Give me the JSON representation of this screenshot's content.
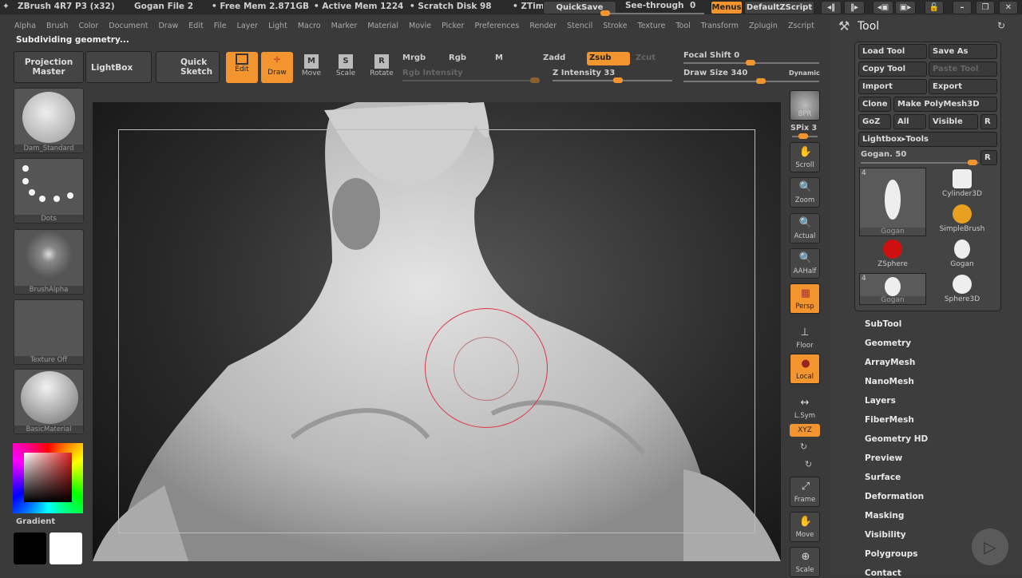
{
  "titlebar": {
    "app": "ZBrush 4R7 P3 (x32)",
    "file": "Gogan File 2",
    "free_mem": "• Free Mem 2.871GB",
    "active_mem": "• Active Mem 1224",
    "scratch": "• Scratch Disk 98",
    "ztime": "• ZTime",
    "quicksave": "QuickSave",
    "see_through": "See-through",
    "see_through_value": "0",
    "menus": "Menus",
    "default_zscript": "DefaultZScript"
  },
  "menu": [
    "Alpha",
    "Brush",
    "Color",
    "Document",
    "Draw",
    "Edit",
    "File",
    "Layer",
    "Light",
    "Macro",
    "Marker",
    "Material",
    "Movie",
    "Picker",
    "Preferences",
    "Render",
    "Stencil",
    "Stroke",
    "Texture",
    "Tool",
    "Transform",
    "Zplugin",
    "Zscript"
  ],
  "status": "Subdividing geometry...",
  "toolbar": {
    "projection_master": "Projection Master",
    "lightbox": "LightBox",
    "quick_sketch": "Quick Sketch",
    "edit": "Edit",
    "draw": "Draw",
    "move": "Move",
    "scale": "Scale",
    "rotate": "Rotate",
    "mrgb": "Mrgb",
    "rgb": "Rgb",
    "m": "M",
    "rgb_intensity": "Rgb Intensity",
    "zadd": "Zadd",
    "zsub": "Zsub",
    "zcut": "Zcut",
    "z_intensity": "Z Intensity 33",
    "focal_shift": "Focal Shift 0",
    "draw_size": "Draw Size 340",
    "dynamic": "Dynamic",
    "z_intensity_value": 33,
    "focal_shift_value": 0,
    "draw_size_value": 340
  },
  "left": {
    "brush": "Dam_Standard",
    "stroke": "Dots",
    "alpha": "BrushAlpha",
    "texture": "Texture Off",
    "material": "BasicMaterial",
    "gradient": "Gradient"
  },
  "shelf": {
    "bpr": "BPR",
    "spix": "SPix 3",
    "scroll": "Scroll",
    "zoom": "Zoom",
    "actual": "Actual",
    "aahalf": "AAHalf",
    "persp": "Persp",
    "floor": "Floor",
    "local": "Local",
    "lsym": "L.Sym",
    "xyz": "XYZ",
    "frame": "Frame",
    "move": "Move",
    "scale": "Scale"
  },
  "tool": {
    "title": "Tool",
    "load": "Load Tool",
    "save_as": "Save As",
    "copy": "Copy Tool",
    "paste": "Paste Tool",
    "import": "Import",
    "export": "Export",
    "clone": "Clone",
    "make_polymesh": "Make PolyMesh3D",
    "goz": "GoZ",
    "all": "All",
    "visible": "Visible",
    "r": "R",
    "lightbox_tools": "Lightbox▸Tools",
    "gogan_slider": "Gogan. 50",
    "thumbs": [
      {
        "name": "Gogan",
        "count": "4"
      },
      {
        "name": "Cylinder3D"
      },
      {
        "name": "SimpleBrush"
      },
      {
        "name": "ZSphere"
      },
      {
        "name": "Gogan"
      },
      {
        "name": "Gogan",
        "count": "4"
      },
      {
        "name": "Sphere3D"
      }
    ],
    "subpalettes": [
      "SubTool",
      "Geometry",
      "ArrayMesh",
      "NanoMesh",
      "Layers",
      "FiberMesh",
      "Geometry HD",
      "Preview",
      "Surface",
      "Deformation",
      "Masking",
      "Visibility",
      "Polygroups",
      "Contact"
    ]
  }
}
